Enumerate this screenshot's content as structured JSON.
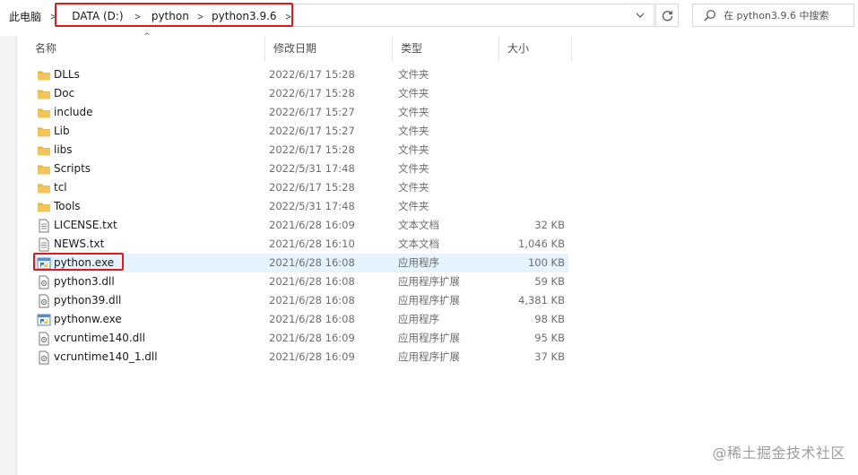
{
  "address": {
    "crumbs": [
      "此电脑",
      "DATA (D:)",
      "python",
      "python3.9.6"
    ],
    "separator": ">"
  },
  "search": {
    "placeholder": "在 python3.9.6 中搜索"
  },
  "columns": {
    "name": "名称",
    "date": "修改日期",
    "type": "类型",
    "size": "大小"
  },
  "files": [
    {
      "name": "DLLs",
      "date": "2022/6/17 15:28",
      "type": "文件夹",
      "size": "",
      "icon": "folder-icon"
    },
    {
      "name": "Doc",
      "date": "2022/6/17 15:28",
      "type": "文件夹",
      "size": "",
      "icon": "folder-icon"
    },
    {
      "name": "include",
      "date": "2022/6/17 15:27",
      "type": "文件夹",
      "size": "",
      "icon": "folder-icon"
    },
    {
      "name": "Lib",
      "date": "2022/6/17 15:27",
      "type": "文件夹",
      "size": "",
      "icon": "folder-icon"
    },
    {
      "name": "libs",
      "date": "2022/6/17 15:28",
      "type": "文件夹",
      "size": "",
      "icon": "folder-icon"
    },
    {
      "name": "Scripts",
      "date": "2022/5/31 17:48",
      "type": "文件夹",
      "size": "",
      "icon": "folder-icon"
    },
    {
      "name": "tcl",
      "date": "2022/6/17 15:28",
      "type": "文件夹",
      "size": "",
      "icon": "folder-icon"
    },
    {
      "name": "Tools",
      "date": "2022/5/31 17:48",
      "type": "文件夹",
      "size": "",
      "icon": "folder-icon"
    },
    {
      "name": "LICENSE.txt",
      "date": "2021/6/28 16:09",
      "type": "文本文档",
      "size": "32 KB",
      "icon": "text-file-icon"
    },
    {
      "name": "NEWS.txt",
      "date": "2021/6/28 16:10",
      "type": "文本文档",
      "size": "1,046 KB",
      "icon": "text-file-icon"
    },
    {
      "name": "python.exe",
      "date": "2021/6/28 16:08",
      "type": "应用程序",
      "size": "100 KB",
      "icon": "python-exe-icon",
      "selected": true
    },
    {
      "name": "python3.dll",
      "date": "2021/6/28 16:08",
      "type": "应用程序扩展",
      "size": "59 KB",
      "icon": "dll-file-icon"
    },
    {
      "name": "python39.dll",
      "date": "2021/6/28 16:08",
      "type": "应用程序扩展",
      "size": "4,381 KB",
      "icon": "dll-file-icon"
    },
    {
      "name": "pythonw.exe",
      "date": "2021/6/28 16:08",
      "type": "应用程序",
      "size": "98 KB",
      "icon": "python-exe-icon"
    },
    {
      "name": "vcruntime140.dll",
      "date": "2021/6/28 16:09",
      "type": "应用程序扩展",
      "size": "95 KB",
      "icon": "dll-file-icon"
    },
    {
      "name": "vcruntime140_1.dll",
      "date": "2021/6/28 16:09",
      "type": "应用程序扩展",
      "size": "37 KB",
      "icon": "dll-file-icon"
    }
  ],
  "watermark": "@稀土掘金技术社区",
  "colors": {
    "highlight": "#e0191b",
    "selection": "#e5f3ff",
    "folder": "#f2c55c"
  }
}
